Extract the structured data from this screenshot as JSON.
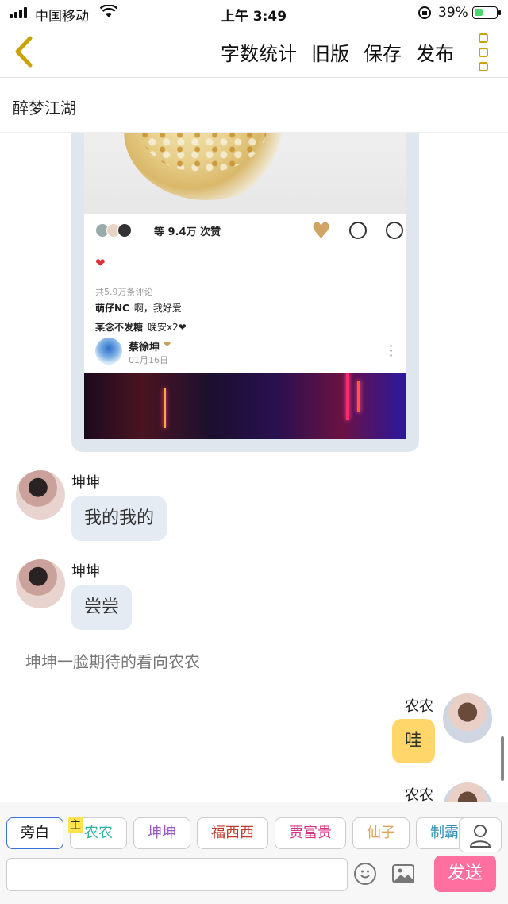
{
  "status_bar": {
    "carrier": "中国移动",
    "time": "上午 3:49",
    "battery": "39%",
    "battery_level": 0.39
  },
  "nav": {
    "word_count": "字数统计",
    "old_version": "旧版",
    "save": "保存",
    "publish": "发布"
  },
  "document": {
    "title": "醉梦江湖"
  },
  "embedded_post": {
    "likes": "等 9.4万 次赞",
    "comment_count": "共5.9万条评论",
    "comments": [
      {
        "user": "萌仔NC",
        "text": "啊，我好爱"
      },
      {
        "user": "某念不发糖",
        "text": "晚安x2❤"
      }
    ],
    "poster_name": "蔡徐坤",
    "poster_date": "01月16日"
  },
  "messages": [
    {
      "speaker": "坤坤",
      "text": "我的我的"
    },
    {
      "speaker": "坤坤",
      "text": "尝尝"
    },
    {
      "narration": "坤坤一脸期待的看向农农"
    },
    {
      "speaker": "农农",
      "text": "哇"
    },
    {
      "speaker": "农农"
    }
  ],
  "roles": {
    "host_tag": "主",
    "chips": [
      {
        "label": "旁白",
        "color": "#111111"
      },
      {
        "label": "农农",
        "color": "#2ab3a6"
      },
      {
        "label": "坤坤",
        "color": "#9b59c6"
      },
      {
        "label": "福西西",
        "color": "#c0392b"
      },
      {
        "label": "贾富贵",
        "color": "#d63384"
      },
      {
        "label": "仙子",
        "color": "#e0a458"
      },
      {
        "label": "制霸",
        "color": "#2b8fb3"
      }
    ]
  },
  "composer": {
    "input_value": "",
    "send_label": "发送"
  },
  "colors": {
    "accent_yellow": "#c9a400",
    "bubble_right": "#ffd66a",
    "bubble_left": "#e4ebf2",
    "send": "#ff6f9f"
  }
}
